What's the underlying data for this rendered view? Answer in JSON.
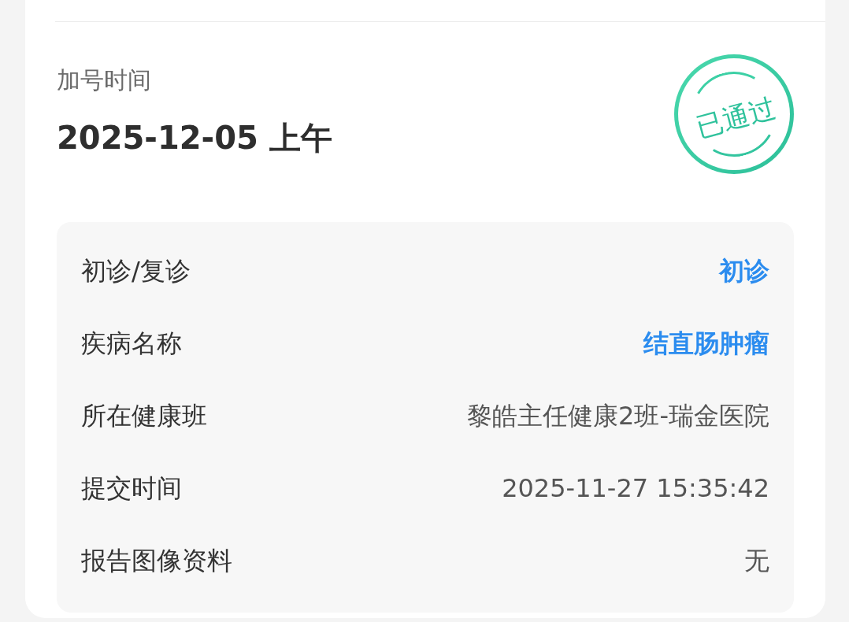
{
  "header": {
    "label": "加号时间",
    "time": "2025-12-05 上午"
  },
  "stamp": {
    "text": "已通过"
  },
  "details": [
    {
      "label": "初诊/复诊",
      "value": "初诊",
      "kind": "highlight"
    },
    {
      "label": "疾病名称",
      "value": "结直肠肿瘤",
      "kind": "highlight"
    },
    {
      "label": "所在健康班",
      "value": "黎皓主任健康2班-瑞金医院",
      "kind": "plain"
    },
    {
      "label": "提交时间",
      "value": "2025-11-27 15:35:42",
      "kind": "plain"
    },
    {
      "label": "报告图像资料",
      "value": "无",
      "kind": "plain"
    }
  ]
}
